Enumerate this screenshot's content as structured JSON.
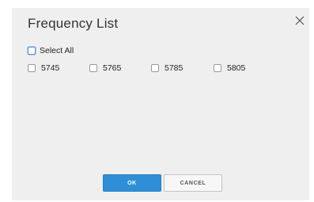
{
  "dialog": {
    "title": "Frequency List",
    "close_icon": "close-icon"
  },
  "select_all": {
    "label": "Select All",
    "checked": false
  },
  "frequencies": [
    {
      "label": "5745",
      "checked": false
    },
    {
      "label": "5765",
      "checked": false
    },
    {
      "label": "5785",
      "checked": false
    },
    {
      "label": "5805",
      "checked": false
    }
  ],
  "buttons": {
    "ok_label": "OK",
    "cancel_label": "CANCEL"
  },
  "colors": {
    "dialog_bg": "#efefef",
    "primary": "#2f8fd6",
    "focus": "#5b8bd6"
  }
}
